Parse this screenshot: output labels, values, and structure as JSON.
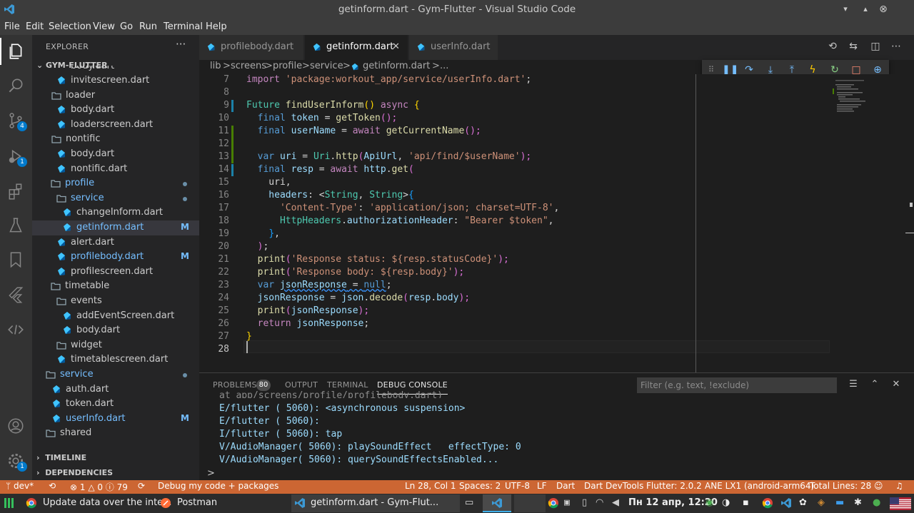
{
  "window": {
    "title": "getinform.dart - Gym-Flutter - Visual Studio Code"
  },
  "menu": [
    "File",
    "Edit",
    "Selection",
    "View",
    "Go",
    "Run",
    "Terminal",
    "Help"
  ],
  "activity": {
    "scm_badge": "4",
    "debug_badge": "1",
    "settings_badge": "1"
  },
  "sidebar": {
    "title": "EXPLORER",
    "more": "···",
    "project": "GYM-FLUTTER",
    "partial_item": "body.dart",
    "tree": [
      {
        "name": "invitescreen.dart",
        "type": "file"
      },
      {
        "name": "loader",
        "type": "folder"
      },
      {
        "name": "body.dart",
        "type": "file"
      },
      {
        "name": "loaderscreen.dart",
        "type": "file"
      },
      {
        "name": "nontific",
        "type": "folder"
      },
      {
        "name": "body.dart",
        "type": "file"
      },
      {
        "name": "nontific.dart",
        "type": "file"
      },
      {
        "name": "profile",
        "type": "folder"
      },
      {
        "name": "service",
        "type": "folder"
      },
      {
        "name": "changeInform.dart",
        "type": "file"
      },
      {
        "name": "getinform.dart",
        "type": "file",
        "status": "M"
      },
      {
        "name": "alert.dart",
        "type": "file"
      },
      {
        "name": "profilebody.dart",
        "type": "file",
        "status": "M"
      },
      {
        "name": "profilescreen.dart",
        "type": "file"
      },
      {
        "name": "timetable",
        "type": "folder"
      },
      {
        "name": "events",
        "type": "folder"
      },
      {
        "name": "addEventScreen.dart",
        "type": "file"
      },
      {
        "name": "body.dart",
        "type": "file"
      },
      {
        "name": "widget",
        "type": "folder"
      },
      {
        "name": "timetablescreen.dart",
        "type": "file"
      },
      {
        "name": "service",
        "type": "folder"
      },
      {
        "name": "auth.dart",
        "type": "file"
      },
      {
        "name": "token.dart",
        "type": "file"
      },
      {
        "name": "userInfo.dart",
        "type": "file",
        "status": "M"
      },
      {
        "name": "shared",
        "type": "folder"
      }
    ],
    "timeline": "TIMELINE",
    "dependencies": "DEPENDENCIES"
  },
  "tabs": [
    {
      "label": "profilebody.dart"
    },
    {
      "label": "getinform.dart",
      "close": "✕"
    },
    {
      "label": "userInfo.dart"
    }
  ],
  "breadcrumb": [
    "lib",
    ">",
    "screens",
    ">",
    "profile",
    ">",
    "service",
    ">",
    "getinform.dart",
    ">",
    "..."
  ],
  "editor": {
    "line_numbers": [
      "7",
      "8",
      "9",
      "10",
      "11",
      "12",
      "13",
      "14",
      "15",
      "16",
      "17",
      "18",
      "19",
      "20",
      "21",
      "22",
      "23",
      "24",
      "25",
      "26",
      "27",
      "28"
    ],
    "code": {
      "l7a": "import ",
      "l7b": "'package:workout_app/service/userInfo.dart'",
      "l7c": ";",
      "l9a": "Future ",
      "l9b": "findUserInform",
      "l9c": "() ",
      "l9d": "async ",
      "l9e": "{",
      "l10a": "  final ",
      "l10b": "token",
      "l10c": " = ",
      "l10d": "getToken",
      "l10e": "();",
      "l11a": "  final ",
      "l11b": "userName",
      "l11c": " = ",
      "l11d": "await ",
      "l11e": "getCurrentName",
      "l11f": "();",
      "l13a": "  var ",
      "l13b": "uri",
      "l13c": " = ",
      "l13d": "Uri",
      "l13e": ".",
      "l13f": "http",
      "l13g": "(",
      "l13h": "ApiUrl",
      "l13i": ", ",
      "l13j": "'api/find/$userName'",
      "l13k": ");",
      "l14a": "  final ",
      "l14b": "resp",
      "l14c": " = ",
      "l14d": "await ",
      "l14e": "http",
      "l14f": ".",
      "l14g": "get",
      "l14h": "(",
      "l15a": "    uri,",
      "l16a": "    headers",
      "l16b": ": <",
      "l16c": "String",
      "l16d": ", ",
      "l16e": "String",
      "l16f": ">",
      "l16g": "{",
      "l17a": "      ",
      "l17b": "'Content-Type'",
      "l17c": ": ",
      "l17d": "'application/json; charset=UTF-8'",
      "l17e": ",",
      "l18a": "      ",
      "l18b": "HttpHeaders",
      "l18c": ".",
      "l18d": "authorizationHeader",
      "l18e": ": ",
      "l18f": "\"Bearer $token\"",
      "l18g": ",",
      "l19a": "    ",
      "l19b": "}",
      "l19c": ",",
      "l20a": "  ",
      "l20b": ")",
      "l20c": ";",
      "l21a": "  ",
      "l21b": "print",
      "l21c": "(",
      "l21d": "'Response status: ${resp.statusCode}'",
      "l21e": ");",
      "l22a": "  ",
      "l22b": "print",
      "l22c": "(",
      "l22d": "'Response body: ${resp.body}'",
      "l22e": ");",
      "l23a": "  var ",
      "l23b": "jsonResponse",
      "l23c": " = ",
      "l23d": "null",
      "l23e": ";",
      "l24a": "  ",
      "l24b": "jsonResponse",
      "l24c": " = ",
      "l24d": "json",
      "l24e": ".",
      "l24f": "decode",
      "l24g": "(",
      "l24h": "resp",
      "l24i": ".",
      "l24j": "body",
      "l24k": ");",
      "l25a": "  ",
      "l25b": "print",
      "l25c": "(",
      "l25d": "jsonResponse",
      "l25e": ");",
      "l26a": "  ",
      "l26b": "return ",
      "l26c": "jsonResponse",
      "l26d": ";",
      "l27a": "}"
    }
  },
  "panel": {
    "tabs": [
      "PROBLEMS",
      "OUTPUT",
      "TERMINAL",
      "DEBUG CONSOLE"
    ],
    "problems_count": "80",
    "filter_placeholder": "Filter (e.g. text, !exclude)",
    "output": [
      "at_app/screens/profile/profilebody.dart)",
      "E/flutter ( 5060): <asynchronous suspension>",
      "E/flutter ( 5060):",
      "I/flutter ( 5060): tap",
      "V/AudioManager( 5060): playSoundEffect   effectType: 0",
      "V/AudioManager( 5060): querySoundEffectsEnabled..."
    ],
    "prompt": ">"
  },
  "statusbar": {
    "branch": "dev*",
    "problems": "⊗ 1 △ 0 ⓘ 79",
    "debug": "Debug my code + packages",
    "position": "Ln 28, Col 1",
    "spaces": "Spaces: 2",
    "encoding": "UTF-8",
    "eol": "LF",
    "language": "Dart",
    "devtools": "Dart DevTools",
    "flutter": "Flutter: 2.0.2",
    "device": "ANE LX1 (android-arm64)",
    "total": "Total Lines: 28",
    "color": "#cc6633"
  },
  "taskbar": {
    "win1": "Update data over the inte...",
    "win2": "Postman",
    "win3": "getinform.dart - Gym-Flut...",
    "clock": "Пн 12 апр, 12:20"
  },
  "colors": {
    "accent": "#007acc",
    "keyword": "#569cd6",
    "control": "#c586c0",
    "string": "#ce9178",
    "function": "#dcdcaa",
    "type": "#4ec9b0",
    "variable": "#9cdcfe"
  }
}
